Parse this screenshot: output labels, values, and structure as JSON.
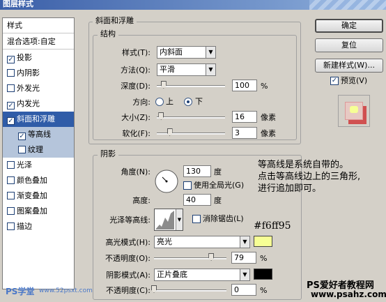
{
  "window": {
    "title": "图层样式"
  },
  "style_list": {
    "header": "样式",
    "blend_options": "混合选项:自定",
    "items": [
      {
        "label": "投影",
        "checked": true
      },
      {
        "label": "内阴影",
        "checked": false
      },
      {
        "label": "外发光",
        "checked": false
      },
      {
        "label": "内发光",
        "checked": true
      },
      {
        "label": "斜面和浮雕",
        "checked": true,
        "selected": true
      },
      {
        "label": "等高线",
        "checked": true,
        "sub": true
      },
      {
        "label": "纹理",
        "checked": false,
        "sub": true
      },
      {
        "label": "光泽",
        "checked": false
      },
      {
        "label": "颜色叠加",
        "checked": false
      },
      {
        "label": "渐变叠加",
        "checked": false
      },
      {
        "label": "图案叠加",
        "checked": false
      },
      {
        "label": "描边",
        "checked": false
      }
    ]
  },
  "bevel": {
    "section_title": "斜面和浮雕",
    "structure_title": "结构",
    "style_label": "样式(T):",
    "style_value": "内斜面",
    "method_label": "方法(Q):",
    "method_value": "平滑",
    "depth_label": "深度(D):",
    "depth_value": "100",
    "depth_unit": "%",
    "depth_level": 0.1,
    "direction_label": "方向:",
    "direction_up": "上",
    "direction_down": "下",
    "direction_selected": "下",
    "size_label": "大小(Z):",
    "size_value": "16",
    "size_unit": "像素",
    "size_level": 0.064,
    "soften_label": "软化(F):",
    "soften_value": "3",
    "soften_unit": "像素",
    "soften_level": 0.19
  },
  "shading": {
    "title": "阴影",
    "angle_label": "角度(N):",
    "angle_value": "130",
    "angle_unit": "度",
    "global_light_label": "使用全局光(G)",
    "global_light_checked": false,
    "altitude_label": "高度:",
    "altitude_value": "40",
    "altitude_unit": "度",
    "gloss_contour_label": "光泽等高线:",
    "antialias_label": "消除锯齿(L)",
    "antialias_checked": false,
    "highlight_mode_label": "高光模式(H):",
    "highlight_mode_value": "亮光",
    "highlight_color": "#f6ff95",
    "highlight_opacity_label": "不透明度(O):",
    "highlight_opacity_value": "79",
    "highlight_opacity_unit": "%",
    "highlight_opacity_level": 0.79,
    "shadow_mode_label": "阴影模式(A):",
    "shadow_mode_value": "正片叠底",
    "shadow_color": "#000000",
    "shadow_opacity_label": "不透明度(C):",
    "shadow_opacity_value": "0",
    "shadow_opacity_unit": "%",
    "shadow_opacity_level": 0.0
  },
  "buttons": {
    "ok": "确定",
    "reset": "复位",
    "new_style": "新建样式(W)...",
    "preview_label": "预览(V)",
    "preview_checked": true
  },
  "annotation": {
    "line1": "等高线是系统自带的。",
    "line2": "点击等高线边上的三角形,",
    "line3": "进行追加即可。",
    "color_code": "#f6ff95"
  },
  "watermarks": {
    "left": "PS学堂",
    "left_url": "www.52psxt.com",
    "right_title": "PS爱好者教程网",
    "right_url": "www.psahz.com"
  }
}
